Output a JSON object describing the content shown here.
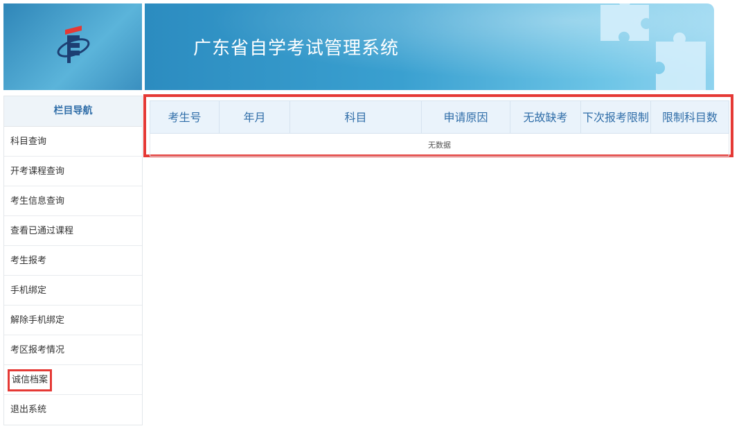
{
  "header": {
    "title": "广东省自学考试管理系统",
    "logo_icon": "exam-authority-logo-icon"
  },
  "sidebar": {
    "heading": "栏目导航",
    "items": [
      {
        "label": "科目查询"
      },
      {
        "label": "开考课程查询"
      },
      {
        "label": "考生信息查询"
      },
      {
        "label": "查看已通过课程"
      },
      {
        "label": "考生报考"
      },
      {
        "label": "手机绑定"
      },
      {
        "label": "解除手机绑定"
      },
      {
        "label": "考区报考情况"
      },
      {
        "label": "诚信档案"
      },
      {
        "label": "退出系统"
      }
    ]
  },
  "table": {
    "columns": [
      "考生号",
      "年月",
      "科目",
      "申请原因",
      "无故缺考",
      "下次报考限制",
      "限制科目数"
    ],
    "empty_text": "无数据"
  },
  "colors": {
    "highlight": "#e53935",
    "header_text": "#2f6da8",
    "header_bg": "#eaf3fb",
    "banner": "#3aa0d0"
  }
}
